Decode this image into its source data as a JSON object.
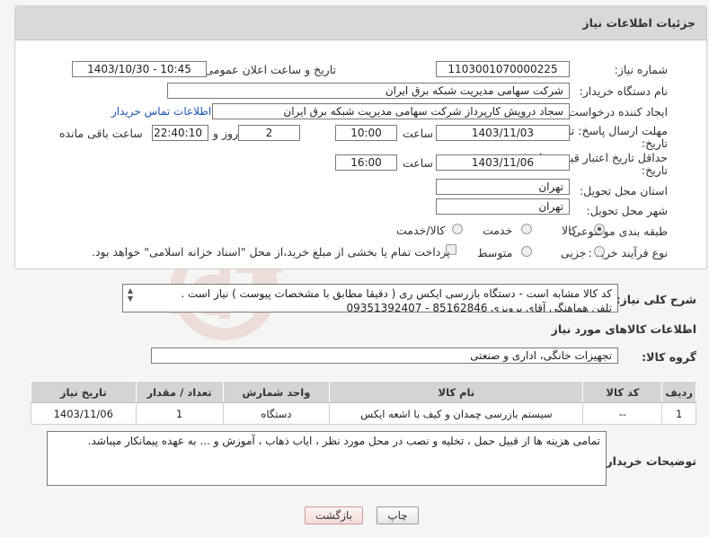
{
  "panel": {
    "title": "جزئیات اطلاعات نیاز"
  },
  "fields": {
    "need_number_label": "شماره نیاز:",
    "need_number": "1103001070000225",
    "announce_label": "تاریخ و ساعت اعلان عمومی:",
    "announce_value": "1403/10/30 - 10:45",
    "buyer_org_label": "نام دستگاه خریدار:",
    "buyer_org": "شرکت سهامی مدیریت شبکه برق ایران",
    "requester_label": "ایجاد کننده درخواست:",
    "requester": "سجاد درویش کارپرداز شرکت سهامی مدیریت شبکه برق ایران",
    "contact_link": "اطلاعات تماس خریدار",
    "deadline_label_1": "مهلت ارسال پاسخ: تا",
    "deadline_label_2": "تاریخ:",
    "deadline_date": "1403/11/03",
    "time_label": "ساعت",
    "deadline_time": "10:00",
    "days_value": "2",
    "days_label": "روز و",
    "remaining_time": "22:40:10",
    "remaining_label": "ساعت باقی مانده",
    "validity_label_1": "حداقل تاریخ اعتبار قیمت: تا",
    "validity_label_2": "تاریخ:",
    "validity_date": "1403/11/06",
    "validity_time": "16:00",
    "province_label": "استان محل تحویل:",
    "province": "تهران",
    "city_label": "شهر محل تحویل:",
    "city": "تهران",
    "category_label": "طبقه بندی موضوعی:",
    "category_options": [
      "کالا",
      "خدمت",
      "کالا/خدمت"
    ],
    "process_label": "نوع فرآیند خرید :",
    "process_options": [
      "جزیی",
      "متوسط"
    ],
    "treasury_note": "پرداخت تمام یا بخشی از مبلغ خرید،از محل \"اسناد خزانه اسلامی\" خواهد بود."
  },
  "description": {
    "label": "شرح کلی نیاز:",
    "line1": "کد کالا مشابه است - دستگاه بازرسی ایکس ری ( دقیقا مطابق با مشخصات پیوست ) نیاز است .",
    "line2": "تلفن هماهنگی آقای پرویزی 85162846 - 09351392407"
  },
  "goods": {
    "section_title": "اطلاعات کالاهای مورد نیاز",
    "group_label": "گروه کالا:",
    "group_value": "تجهیزات خانگی، اداری و صنعتی"
  },
  "table": {
    "headers": [
      "ردیف",
      "کد کالا",
      "نام کالا",
      "واحد شمارش",
      "تعداد / مقدار",
      "تاریخ نیاز"
    ],
    "rows": [
      [
        "1",
        "--",
        "سیستم بازرسی چمدان و کیف با اشعه ایکس",
        "دستگاه",
        "1",
        "1403/11/06"
      ]
    ]
  },
  "buyer_notes": {
    "label": "توضیحات خریدار:",
    "text": "تمامی هزینه ها از قبیل حمل ، تخلیه و نصب در محل مورد نظر ، ایاب ذهاب ، آموزش و ... به عهده پیمانکار میباشد."
  },
  "buttons": {
    "print": "چاپ",
    "back": "بازگشت"
  },
  "watermark": {
    "text": "AriaTender.neT"
  },
  "colors": {
    "link": "#1a55b5",
    "header_bg": "#d9d9d9",
    "watermark": "#c0392b"
  }
}
